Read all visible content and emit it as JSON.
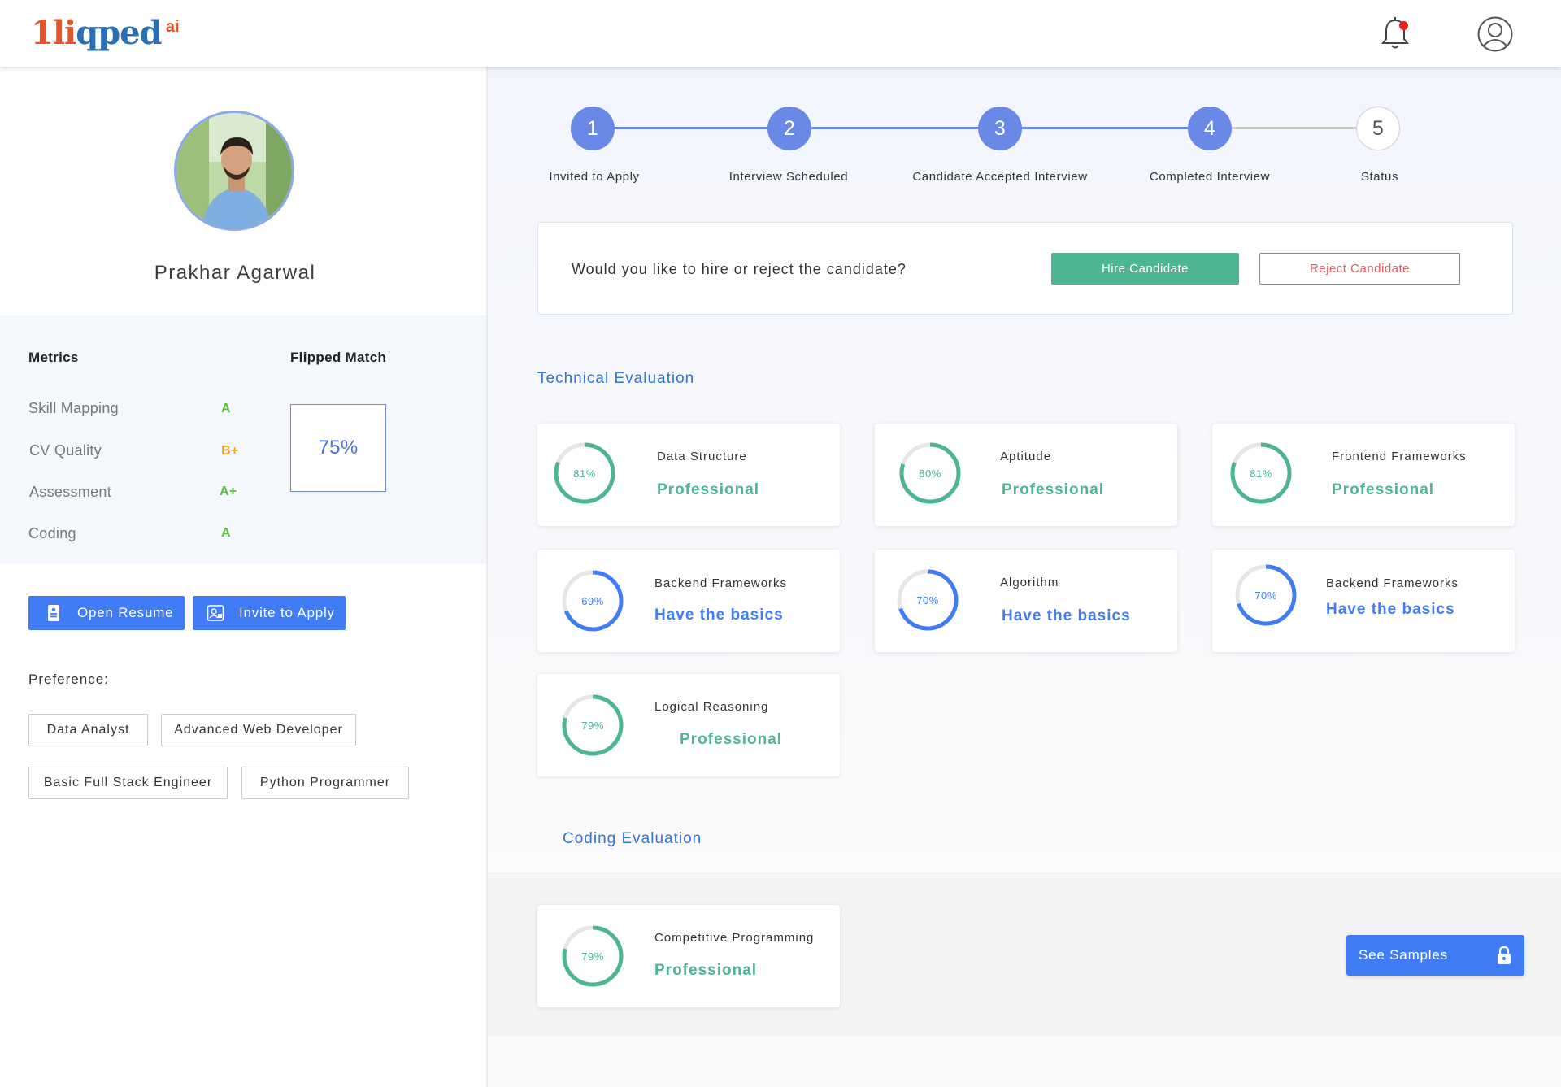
{
  "header": {
    "logo_main_a": "1li",
    "logo_main_b": "qped",
    "logo_sup": "ai",
    "icons": [
      "bell-icon",
      "user-profile-icon"
    ],
    "notification_dot_color": "#e0251b"
  },
  "candidate": {
    "name": "Prakhar Agarwal"
  },
  "metrics": {
    "title": "Metrics",
    "match_title": "Flipped Match",
    "match_value": "75%",
    "items": [
      {
        "label": "Skill Mapping",
        "grade": "A",
        "color": "#5bbf3c"
      },
      {
        "label": "CV Quality",
        "grade": "B+",
        "color": "#f2a91b"
      },
      {
        "label": "Assessment",
        "grade": "A+",
        "color": "#5bbf3c"
      },
      {
        "label": "Coding",
        "grade": "A",
        "color": "#5bbf3c"
      }
    ]
  },
  "actions": {
    "open_resume": "Open Resume",
    "invite_apply": "Invite to Apply"
  },
  "preference": {
    "title": "Preference:",
    "chips": [
      "Data Analyst",
      "Advanced Web Developer",
      "Basic Full Stack Engineer",
      "Python Programmer"
    ]
  },
  "steps": [
    {
      "number": "1",
      "label": "Invited to Apply",
      "done": true
    },
    {
      "number": "2",
      "label": "Interview Scheduled",
      "done": true
    },
    {
      "number": "3",
      "label": "Candidate Accepted Interview",
      "done": true
    },
    {
      "number": "4",
      "label": "Completed Interview",
      "done": true
    },
    {
      "number": "5",
      "label": "Status",
      "done": false
    }
  ],
  "hire": {
    "question": "Would you like to hire or reject the candidate?",
    "hire_label": "Hire Candidate",
    "reject_label": "Reject Candidate"
  },
  "technical": {
    "title": "Technical Evaluation",
    "cards": [
      {
        "name": "Data Structure",
        "percent": "81%",
        "value": 81,
        "level": "Professional",
        "tone": "green"
      },
      {
        "name": "Aptitude",
        "percent": "80%",
        "value": 80,
        "level": "Professional",
        "tone": "green"
      },
      {
        "name": "Frontend Frameworks",
        "percent": "81%",
        "value": 81,
        "level": "Professional",
        "tone": "green"
      },
      {
        "name": "Backend Frameworks",
        "percent": "69%",
        "value": 69,
        "level": "Have the basics",
        "tone": "blue"
      },
      {
        "name": "Algorithm",
        "percent": "70%",
        "value": 70,
        "level": "Have the basics",
        "tone": "blue"
      },
      {
        "name": "Backend Frameworks",
        "percent": "70%",
        "value": 70,
        "level": "Have the basics",
        "tone": "blue"
      },
      {
        "name": "Logical Reasoning",
        "percent": "79%",
        "value": 79,
        "level": "Professional",
        "tone": "green"
      }
    ]
  },
  "coding": {
    "title": "Coding Evaluation",
    "cards": [
      {
        "name": "Competitive Programming",
        "percent": "79%",
        "value": 79,
        "level": "Professional",
        "tone": "green"
      }
    ],
    "samples_label": "See Samples"
  },
  "colors": {
    "accent_blue": "#3f7cf5",
    "step_blue": "#6a88e6",
    "success_green": "#4db58f",
    "danger_red": "#e06063"
  }
}
